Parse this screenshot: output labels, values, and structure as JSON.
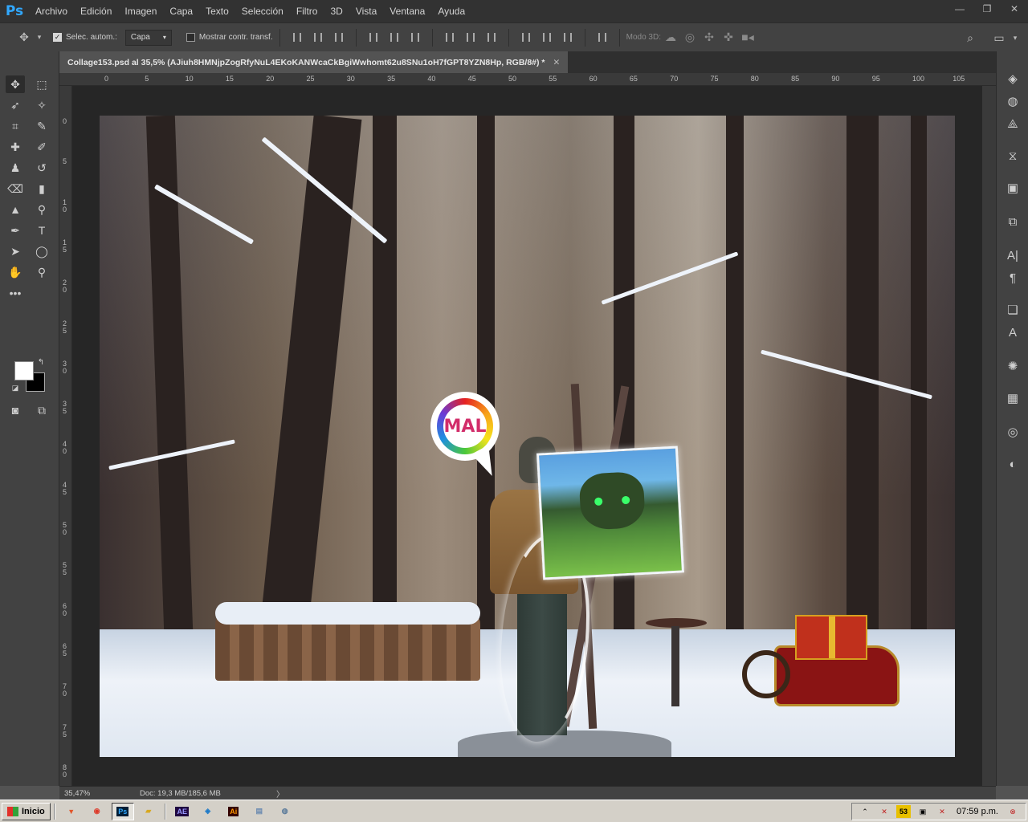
{
  "app": {
    "logo": "Ps",
    "menu": [
      "Archivo",
      "Edición",
      "Imagen",
      "Capa",
      "Texto",
      "Selección",
      "Filtro",
      "3D",
      "Vista",
      "Ventana",
      "Ayuda"
    ],
    "window_controls": {
      "minimize": "—",
      "restore": "❐",
      "close": "✕"
    }
  },
  "options": {
    "auto_select_label": "Selec. autom.:",
    "auto_select_checked": true,
    "auto_select_target": "Capa",
    "show_transform_label": "Mostrar contr. transf.",
    "show_transform_checked": false,
    "mode3d_label": "Modo 3D:"
  },
  "document": {
    "tab_title": "Collage153.psd al 35,5% (AJiuh8HMNjpZogRfyNuL4EKoKANWcaCkBgiWwhomt62u8SNu1oH7fGPT8YZN8Hp, RGB/8#) *",
    "close": "✕"
  },
  "rulers": {
    "top": [
      "0",
      "5",
      "10",
      "15",
      "20",
      "25",
      "30",
      "35",
      "40",
      "45",
      "50",
      "55",
      "60",
      "65",
      "70",
      "75",
      "80",
      "85",
      "90",
      "95",
      "100",
      "105"
    ],
    "left": [
      "0",
      "5",
      "1 0",
      "1 5",
      "2 0",
      "2 5",
      "3 0",
      "3 5",
      "4 0",
      "4 5",
      "5 0",
      "5 5",
      "6 0",
      "6 5",
      "7 0",
      "7 5",
      "8 0"
    ]
  },
  "artwork": {
    "speech_logo_text": "MAL"
  },
  "status": {
    "zoom": "35,47%",
    "doc_size": "Doc: 19,3 MB/185,6 MB",
    "arrow": "〉"
  },
  "colors": {
    "foreground": "#ffffff",
    "background": "#000000",
    "accent": "#31a8ff"
  },
  "taskbar": {
    "start_label": "Inicio",
    "apps": [
      "brave-icon",
      "chrome-icon",
      "photoshop-icon",
      "folder-icon",
      "after-effects-icon",
      "network-icon",
      "illustrator-icon",
      "notepad-icon",
      "media-icon"
    ],
    "app_labels": {
      "ps": "Ps",
      "ae": "AE",
      "ai": "Ai"
    },
    "clock": "07:59 p.m."
  }
}
